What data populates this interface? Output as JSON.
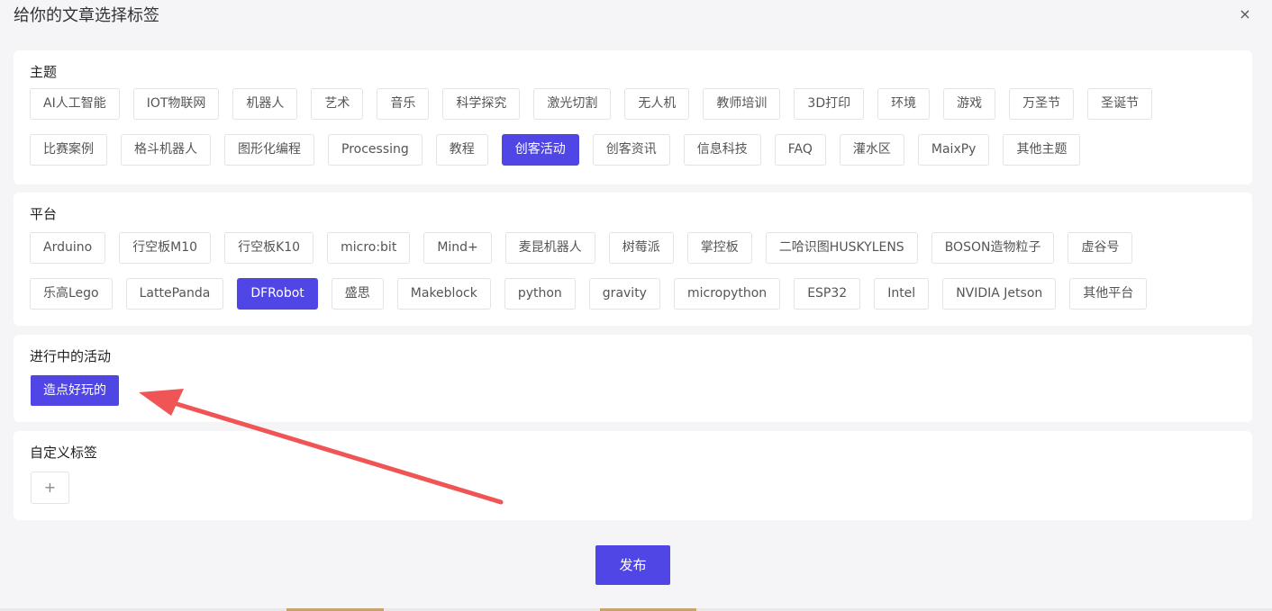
{
  "dialog": {
    "title": "给你的文章选择标签",
    "close_label": "×"
  },
  "sections": {
    "topics": {
      "title": "主题",
      "rows": [
        [
          "AI人工智能",
          "IOT物联网",
          "机器人",
          "艺术",
          "音乐",
          "科学探究",
          "激光切割",
          "无人机",
          "教师培训",
          "3D打印",
          "环境",
          "游戏",
          "万圣节",
          "圣诞节"
        ],
        [
          "比赛案例",
          "格斗机器人",
          "图形化编程",
          "Processing",
          "教程",
          "创客活动",
          "创客资讯",
          "信息科技",
          "FAQ",
          "灌水区",
          "MaixPy",
          "其他主题"
        ]
      ],
      "selected": "创客活动"
    },
    "platforms": {
      "title": "平台",
      "rows": [
        [
          "Arduino",
          "行空板M10",
          "行空板K10",
          "micro:bit",
          "Mind+",
          "麦昆机器人",
          "树莓派",
          "掌控板",
          "二哈识图HUSKYLENS",
          "BOSON造物粒子",
          "虚谷号"
        ],
        [
          "乐高Lego",
          "LattePanda",
          "DFRobot",
          "盛思",
          "Makeblock",
          "python",
          "gravity",
          "micropython",
          "ESP32",
          "Intel",
          "NVIDIA Jetson",
          "其他平台"
        ]
      ],
      "selected": "DFRobot"
    },
    "activities": {
      "title": "进行中的活动",
      "tag": "造点好玩的"
    },
    "custom": {
      "title": "自定义标签",
      "add_label": "+"
    }
  },
  "footer": {
    "publish_label": "发布"
  },
  "colors": {
    "accent": "#4f46e5",
    "annotation_arrow": "#f05555"
  }
}
